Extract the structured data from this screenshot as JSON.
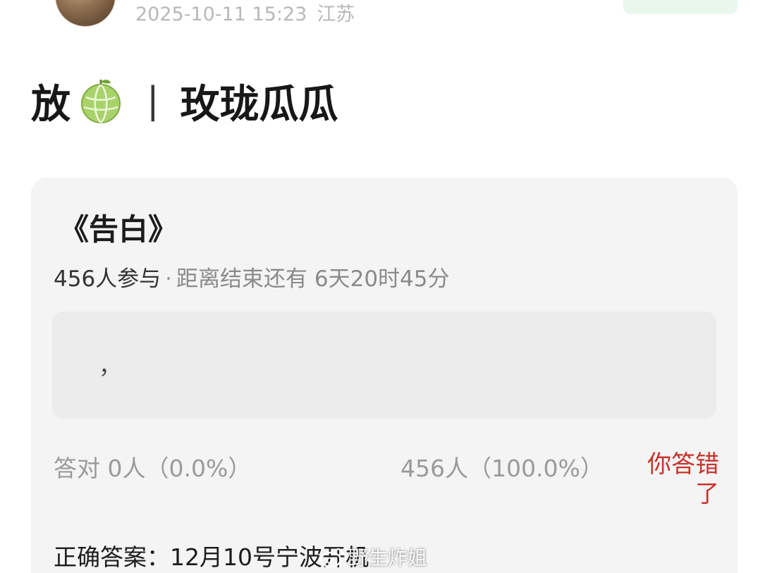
{
  "post": {
    "timestamp": "2025-10-11 15:23",
    "location": "江苏",
    "title_prefix": "放",
    "title_separator": "|",
    "title_main": "玫珑瓜瓜"
  },
  "quiz": {
    "title": "《告白》",
    "participants": "456人参与",
    "separator": "·",
    "countdown": "距离结束还有 6天20时45分",
    "answer_text": "，",
    "correct_stat": "答对  0人（0.0%）",
    "wrong_stat": "456人（100.0%）",
    "wrong_tag": "你答错了",
    "correct_answer": "正确答案：12月10号宁波开机"
  },
  "watermark": {
    "text": "野生炸姐",
    "icon": "weibo-icon"
  },
  "colors": {
    "accent_wrong": "#c8322b",
    "follow_button_bg": "#e9f7ec",
    "card_bg": "#f4f4f4"
  }
}
